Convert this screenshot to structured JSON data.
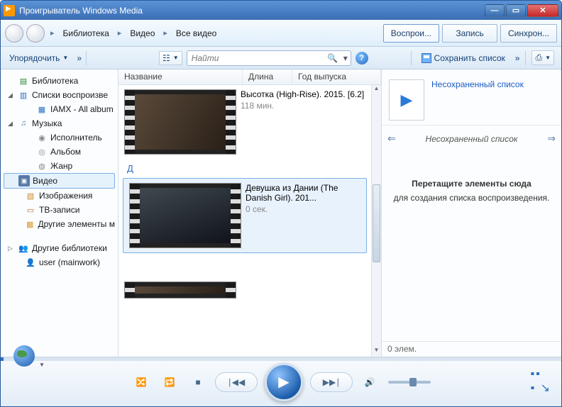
{
  "window": {
    "title": "Проигрыватель Windows Media"
  },
  "nav": {
    "crumbs": [
      "Библиотека",
      "Видео",
      "Все видео"
    ],
    "tabs": {
      "play": "Воспрои...",
      "burn": "Запись",
      "sync": "Синхрон..."
    }
  },
  "toolbar": {
    "organize": "Упорядочить",
    "chevrons": "»",
    "search_placeholder": "Найти",
    "save_list": "Сохранить список"
  },
  "columns": {
    "name": "Название",
    "length": "Длина",
    "year": "Год выпуска"
  },
  "tree": {
    "library": "Библиотека",
    "playlists": "Списки воспроизве",
    "playlist1": "IAMX - All album",
    "music": "Музыка",
    "artist": "Исполнитель",
    "album": "Альбом",
    "genre": "Жанр",
    "video": "Видео",
    "images": "Изображения",
    "tv": "ТВ-записи",
    "other": "Другие элементы м",
    "other_libs": "Другие библиотеки",
    "user": "user (mainwork)"
  },
  "groups": {
    "d": "Д"
  },
  "videos": [
    {
      "title": "Высотка (High-Rise). 2015. [6.2]",
      "duration": "118 мин."
    },
    {
      "title": "Девушка из Дании (The Danish Girl). 201...",
      "duration": "0 сек."
    }
  ],
  "playlist": {
    "unsaved_link": "Несохраненный список",
    "unsaved_title": "Несохраненный список",
    "drop_bold": "Перетащите элементы сюда",
    "drop_line": "для создания списка воспроизведения.",
    "status": "0 элем."
  }
}
